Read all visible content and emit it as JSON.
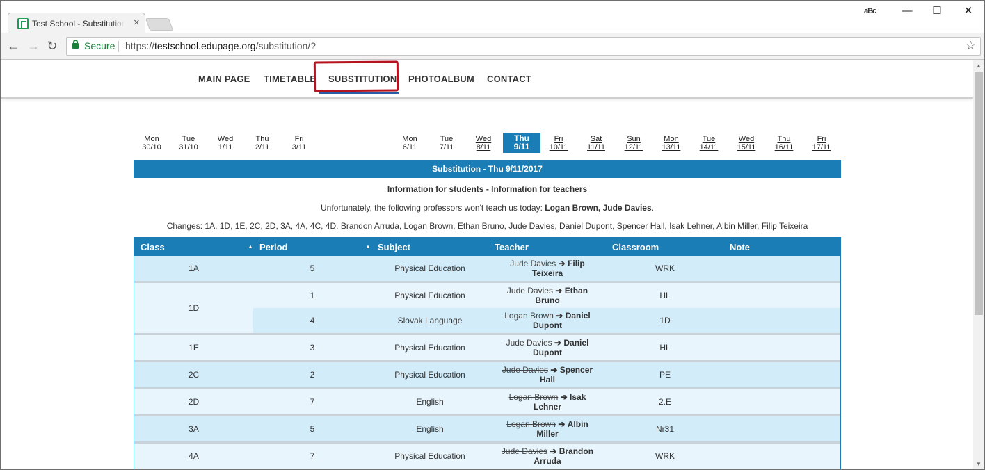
{
  "browser": {
    "tab_title": "Test School - Substitution",
    "tab_close": "×",
    "profile_label": "aBc",
    "window_controls": {
      "minimize": "—",
      "maximize": "☐",
      "close": "✕"
    },
    "nav": {
      "back": "←",
      "forward": "→",
      "reload": "↻"
    },
    "secure_label": "Secure",
    "url_scheme": "https://",
    "url_host": "testschool.edupage.org",
    "url_path": "/substitution/?",
    "bookmark_icon": "☆"
  },
  "site_nav": {
    "items": [
      "MAIN PAGE",
      "TIMETABLE",
      "SUBSTITUTION",
      "PHOTOALBUM",
      "CONTACT"
    ],
    "active": "SUBSTITUTION"
  },
  "days": [
    {
      "dow": "Mon",
      "date": "30/10"
    },
    {
      "dow": "Tue",
      "date": "31/10"
    },
    {
      "dow": "Wed",
      "date": "1/11"
    },
    {
      "dow": "Thu",
      "date": "2/11"
    },
    {
      "dow": "Fri",
      "date": "3/11"
    },
    {
      "dow": "Mon",
      "date": "6/11"
    },
    {
      "dow": "Tue",
      "date": "7/11"
    },
    {
      "dow": "Wed",
      "date": "8/11"
    },
    {
      "dow": "Thu",
      "date": "9/11"
    },
    {
      "dow": "Fri",
      "date": "10/11"
    },
    {
      "dow": "Sat",
      "date": "11/11"
    },
    {
      "dow": "Sun",
      "date": "12/11"
    },
    {
      "dow": "Mon",
      "date": "13/11"
    },
    {
      "dow": "Tue",
      "date": "14/11"
    },
    {
      "dow": "Wed",
      "date": "15/11"
    },
    {
      "dow": "Thu",
      "date": "16/11"
    },
    {
      "dow": "Fri",
      "date": "17/11"
    }
  ],
  "substitution_title": "Substitution - Thu 9/11/2017",
  "info": {
    "students_label": "Information for students",
    "separator": " - ",
    "teachers_link": "Information for teachers",
    "absent_prefix": "Unfortunately, the following professors won't teach us today: ",
    "absent_names": "Logan Brown, Jude Davies",
    "absent_suffix": ".",
    "changes": "Changes: 1A, 1D, 1E, 2C, 2D, 3A, 4A, 4C, 4D, Brandon Arruda, Logan Brown, Ethan Bruno, Jude Davies, Daniel Dupont, Spencer Hall, Isak Lehner, Albin Miller, Filip Teixeira"
  },
  "table": {
    "headers": {
      "class": "Class",
      "period": "Period",
      "subject": "Subject",
      "teacher": "Teacher",
      "classroom": "Classroom",
      "note": "Note"
    },
    "sort_icon": "▲",
    "arrow": "➔",
    "rows": [
      {
        "class": "1A",
        "period": "5",
        "subject": "Physical Education",
        "old_teacher": "Jude Davies",
        "new_teacher_a": "Filip",
        "new_teacher_b": "Teixeira",
        "room": "WRK"
      },
      {
        "class": "1D",
        "period": "1",
        "subject": "Physical Education",
        "old_teacher": "Jude Davies",
        "new_teacher_a": "Ethan",
        "new_teacher_b": "Bruno",
        "room": "HL"
      },
      {
        "class": "1D",
        "period": "4",
        "subject": "Slovak Language",
        "old_teacher": "Logan Brown",
        "new_teacher_a": "Daniel",
        "new_teacher_b": "Dupont",
        "room": "1D"
      },
      {
        "class": "1E",
        "period": "3",
        "subject": "Physical Education",
        "old_teacher": "Jude Davies",
        "new_teacher_a": "Daniel",
        "new_teacher_b": "Dupont",
        "room": "HL"
      },
      {
        "class": "2C",
        "period": "2",
        "subject": "Physical Education",
        "old_teacher": "Jude Davies",
        "new_teacher_a": "Spencer",
        "new_teacher_b": "Hall",
        "room": "PE"
      },
      {
        "class": "2D",
        "period": "7",
        "subject": "English",
        "old_teacher": "Logan Brown",
        "new_teacher_a": "Isak",
        "new_teacher_b": "Lehner",
        "room": "2.E"
      },
      {
        "class": "3A",
        "period": "5",
        "subject": "English",
        "old_teacher": "Logan Brown",
        "new_teacher_a": "Albin",
        "new_teacher_b": "Miller",
        "room": "Nr31"
      },
      {
        "class": "4A",
        "period": "7",
        "subject": "Physical Education",
        "old_teacher": "Jude Davies",
        "new_teacher_a": "Brandon",
        "new_teacher_b": "Arruda",
        "room": "WRK"
      }
    ]
  },
  "colors": {
    "accent": "#1a7db5",
    "row_light": "#e8f5fd",
    "row_dark": "#d2ecfa",
    "highlight": "#b5131f"
  }
}
